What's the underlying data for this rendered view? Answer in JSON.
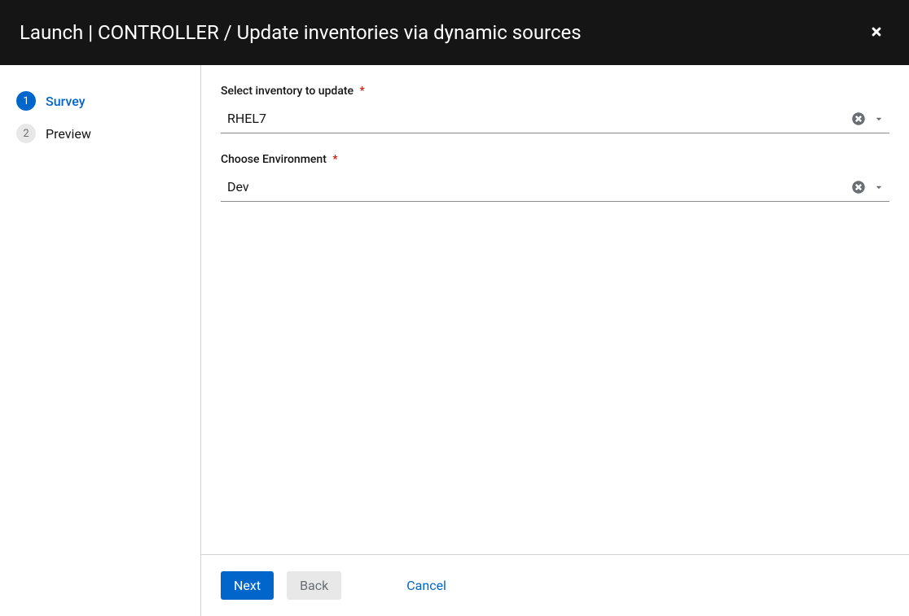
{
  "header": {
    "title": "Launch | CONTROLLER / Update inventories via dynamic sources"
  },
  "wizard": {
    "steps": [
      {
        "number": "1",
        "label": "Survey",
        "active": true
      },
      {
        "number": "2",
        "label": "Preview",
        "active": false
      }
    ]
  },
  "form": {
    "fields": [
      {
        "label": "Select inventory to update",
        "required": true,
        "value": "RHEL7"
      },
      {
        "label": "Choose Environment",
        "required": true,
        "value": "Dev"
      }
    ]
  },
  "footer": {
    "next": "Next",
    "back": "Back",
    "cancel": "Cancel"
  },
  "required_marker": "*"
}
